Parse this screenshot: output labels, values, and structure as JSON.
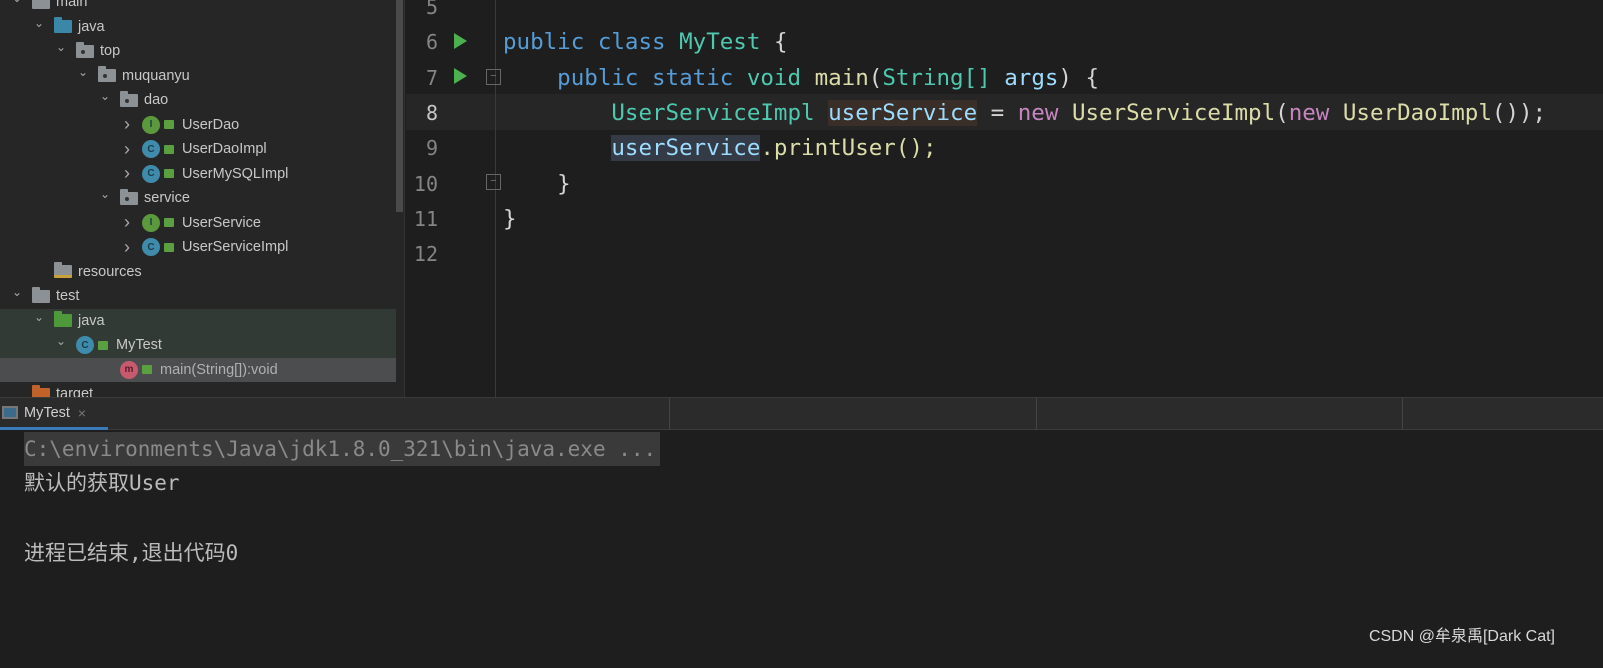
{
  "tree": [
    {
      "label": "main",
      "depth": 0,
      "open": true,
      "icon": "folder",
      "color": "#8c9196"
    },
    {
      "label": "java",
      "depth": 1,
      "open": true,
      "icon": "folder",
      "color": "#3a87a8"
    },
    {
      "label": "top",
      "depth": 2,
      "open": true,
      "icon": "package",
      "color": "#8c9196"
    },
    {
      "label": "muquanyu",
      "depth": 3,
      "open": true,
      "icon": "package",
      "color": "#8c9196"
    },
    {
      "label": "dao",
      "depth": 4,
      "open": true,
      "icon": "package",
      "color": "#8c9196"
    },
    {
      "label": "UserDao",
      "depth": 5,
      "open": false,
      "icon": "interface",
      "color": "#5b9a3c",
      "letter": "I"
    },
    {
      "label": "UserDaoImpl",
      "depth": 5,
      "open": false,
      "icon": "class",
      "color": "#3e8bab",
      "letter": "C"
    },
    {
      "label": "UserMySQLImpl",
      "depth": 5,
      "open": false,
      "icon": "class",
      "color": "#3e8bab",
      "letter": "C"
    },
    {
      "label": "service",
      "depth": 4,
      "open": true,
      "icon": "package",
      "color": "#8c9196"
    },
    {
      "label": "UserService",
      "depth": 5,
      "open": false,
      "icon": "interface",
      "color": "#5b9a3c",
      "letter": "I"
    },
    {
      "label": "UserServiceImpl",
      "depth": 5,
      "open": false,
      "icon": "class",
      "color": "#3e8bab",
      "letter": "C"
    },
    {
      "label": "resources",
      "depth": 1,
      "icon": "resources-folder",
      "color": "#8c9196"
    },
    {
      "label": "test",
      "depth": 0,
      "open": true,
      "icon": "folder",
      "color": "#8c9196"
    },
    {
      "label": "java",
      "depth": 1,
      "open": true,
      "icon": "folder",
      "color": "#4e9a3a",
      "state": "selected-inactive"
    },
    {
      "label": "MyTest",
      "depth": 2,
      "open": true,
      "icon": "class",
      "color": "#3e8bab",
      "letter": "C",
      "state": "selected-inactive"
    },
    {
      "label": "main(String[]):void",
      "depth": 4,
      "icon": "method",
      "color": "#c75a6f",
      "letter": "m",
      "state": "selected"
    },
    {
      "label": "target",
      "depth": 0,
      "icon": "folder",
      "color": "#c0622a"
    }
  ],
  "editor": {
    "line_numbers": [
      "5",
      "6",
      "7",
      "8",
      "9",
      "10",
      "11",
      "12"
    ],
    "lines": [
      [],
      [
        {
          "t": "public ",
          "k": "kw"
        },
        {
          "t": "class ",
          "k": "kw"
        },
        {
          "t": "MyTest ",
          "k": "cls"
        },
        {
          "t": "{",
          "k": "p"
        }
      ],
      [
        {
          "t": "    public ",
          "k": "kw"
        },
        {
          "t": "static ",
          "k": "kw"
        },
        {
          "t": "void ",
          "k": "cls"
        },
        {
          "t": "main",
          "k": "fn"
        },
        {
          "t": "(",
          "k": "p"
        },
        {
          "t": "String[] ",
          "k": "cls"
        },
        {
          "t": "args",
          "k": "var"
        },
        {
          "t": ") {",
          "k": "p"
        }
      ],
      [
        {
          "t": "        UserServiceImpl ",
          "k": "cls"
        },
        {
          "t": "userService",
          "k": "hl1"
        },
        {
          "t": " = ",
          "k": "p"
        },
        {
          "t": "new ",
          "k": "new"
        },
        {
          "t": "UserServiceImpl",
          "k": "fn"
        },
        {
          "t": "(",
          "k": "p"
        },
        {
          "t": "new ",
          "k": "new"
        },
        {
          "t": "UserDaoImpl",
          "k": "fn"
        },
        {
          "t": "());",
          "k": "p"
        }
      ],
      [
        {
          "t": "        ",
          "k": "p"
        },
        {
          "t": "userService",
          "k": "hl2"
        },
        {
          "t": ".printUser();",
          "k": "fn"
        }
      ],
      [
        {
          "t": "    }",
          "k": "p"
        }
      ],
      [
        {
          "t": "}",
          "k": "p"
        }
      ],
      []
    ]
  },
  "run_panel": {
    "tab_label": "MyTest",
    "close_icon": "×",
    "output": [
      "C:\\environments\\Java\\jdk1.8.0_321\\bin\\java.exe ...",
      "默认的获取User",
      "",
      "进程已结束,退出代码0"
    ]
  },
  "watermark": "CSDN @牟泉禹[Dark Cat]"
}
